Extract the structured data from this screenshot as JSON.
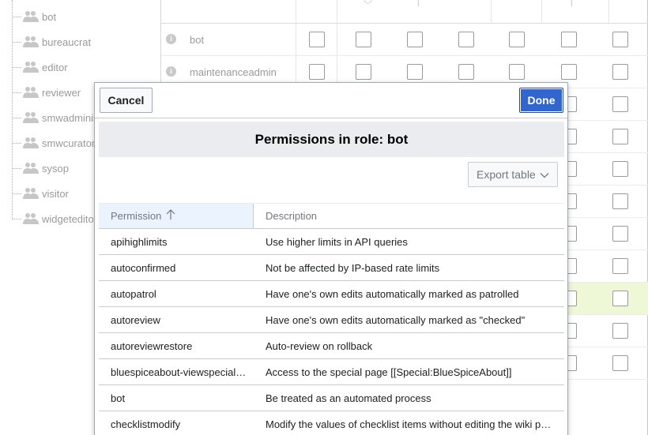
{
  "tree": {
    "groups": [
      "bot",
      "bureaucrat",
      "editor",
      "reviewer",
      "smwadministrator",
      "smwcurator",
      "sysop",
      "visitor",
      "widgeteditor"
    ]
  },
  "grid": {
    "roles": [
      "bot",
      "maintenanceadmin"
    ],
    "highlight_color": "#eef7d6"
  },
  "dialog": {
    "cancel_label": "Cancel",
    "done_label": "Done",
    "title": "Permissions in role: bot",
    "export_label": "Export table",
    "columns": {
      "permission": "Permission",
      "description": "Description"
    },
    "rows": [
      {
        "permission": "apihighlimits",
        "description": "Use higher limits in API queries"
      },
      {
        "permission": "autoconfirmed",
        "description": "Not be affected by IP-based rate limits"
      },
      {
        "permission": "autopatrol",
        "description": "Have one's own edits automatically marked as patrolled"
      },
      {
        "permission": "autoreview",
        "description": "Have one's own edits automatically marked as \"checked\""
      },
      {
        "permission": "autoreviewrestore",
        "description": "Auto-review on rollback"
      },
      {
        "permission": "bluespiceabout-viewspecialpage",
        "description": "Access to the special page [[Special:BlueSpiceAbout]]"
      },
      {
        "permission": "bot",
        "description": "Be treated as an automated process"
      },
      {
        "permission": "checklistmodify",
        "description": "Modify the values of checklist items without editing the wiki page"
      }
    ],
    "accent_color": "#3366cc"
  }
}
